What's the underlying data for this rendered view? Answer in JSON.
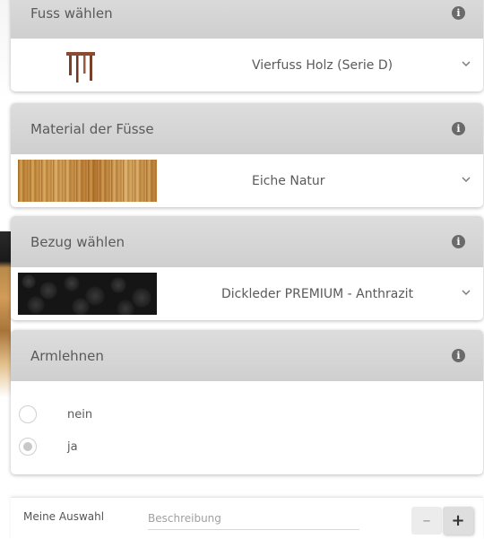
{
  "panels": {
    "foot": {
      "title": "Fuss wählen",
      "selected": "Vierfuss Holz (Serie D)",
      "thumbnail_icon": "wooden-four-leg-frame-icon"
    },
    "foot_material": {
      "title": "Material der Füsse",
      "selected": "Eiche Natur",
      "swatch": "oak-wood-swatch"
    },
    "cover": {
      "title": "Bezug wählen",
      "selected": "Dickleder PREMIUM - Anthrazit",
      "swatch": "black-leather-swatch"
    },
    "armrests": {
      "title": "Armlehnen",
      "options": [
        {
          "label": "nein",
          "selected": false
        },
        {
          "label": "ja",
          "selected": true
        }
      ]
    }
  },
  "footer": {
    "my_choice_label": "Meine Auswahl",
    "description_placeholder": "Beschreibung",
    "minus_label": "–",
    "plus_label": "+"
  },
  "colors": {
    "header_bg": "#d5d5d5",
    "text": "#5a5a5a",
    "info_icon": "#6a6a6a"
  }
}
